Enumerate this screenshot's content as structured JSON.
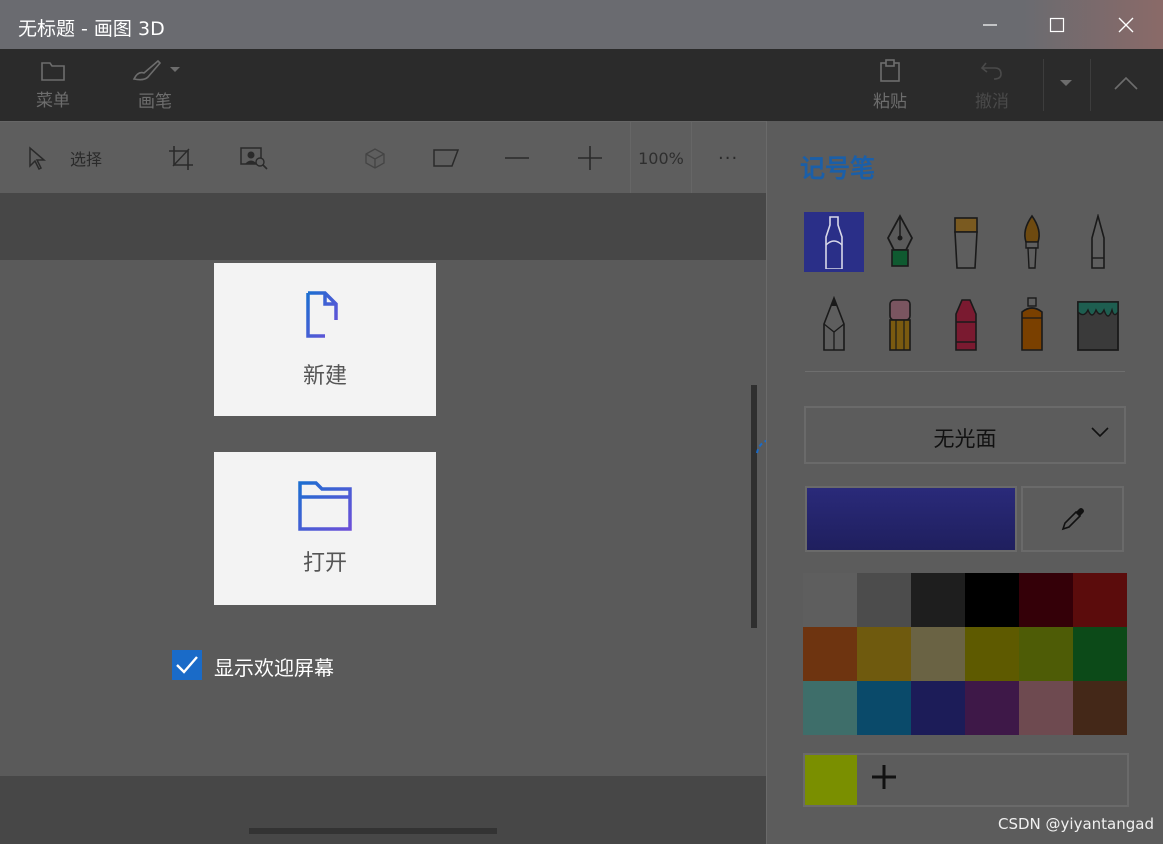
{
  "window": {
    "title": "无标题 - 画图 3D"
  },
  "commandbar": {
    "menu_label": "菜单",
    "brush_label": "画笔",
    "paste_label": "粘贴",
    "undo_label": "撤消"
  },
  "toolbar": {
    "select_label": "选择",
    "zoom": "100%",
    "more": "···"
  },
  "welcome": {
    "new_label": "新建",
    "open_label": "打开",
    "show_welcome_label": "显示欢迎屏幕",
    "show_welcome_checked": true
  },
  "panel": {
    "title": "记号笔",
    "brushes": [
      "marker-icon",
      "calligraphy-pen-icon",
      "oil-brush-icon",
      "watercolor-icon",
      "pixel-pen-icon",
      "pencil-icon",
      "eraser-icon",
      "crayon-icon",
      "spray-can-icon",
      "fill-bucket-icon"
    ],
    "finish": "无光面",
    "current_color": "#1f1f5e",
    "palette": [
      "#5e5e5e",
      "#4c4c4c",
      "#1e1e1e",
      "#000000",
      "#340008",
      "#5b0c0c",
      "#6e3410",
      "#6f5a0e",
      "#6a6344",
      "#5e5a00",
      "#4e5c06",
      "#0c4a18",
      "#3e6e6a",
      "#0a4a6a",
      "#1c1c58",
      "#3e1848",
      "#6e4a50",
      "#442818"
    ],
    "custom_color": "#7a8f00"
  },
  "watermark": "CSDN @yiyantangad"
}
